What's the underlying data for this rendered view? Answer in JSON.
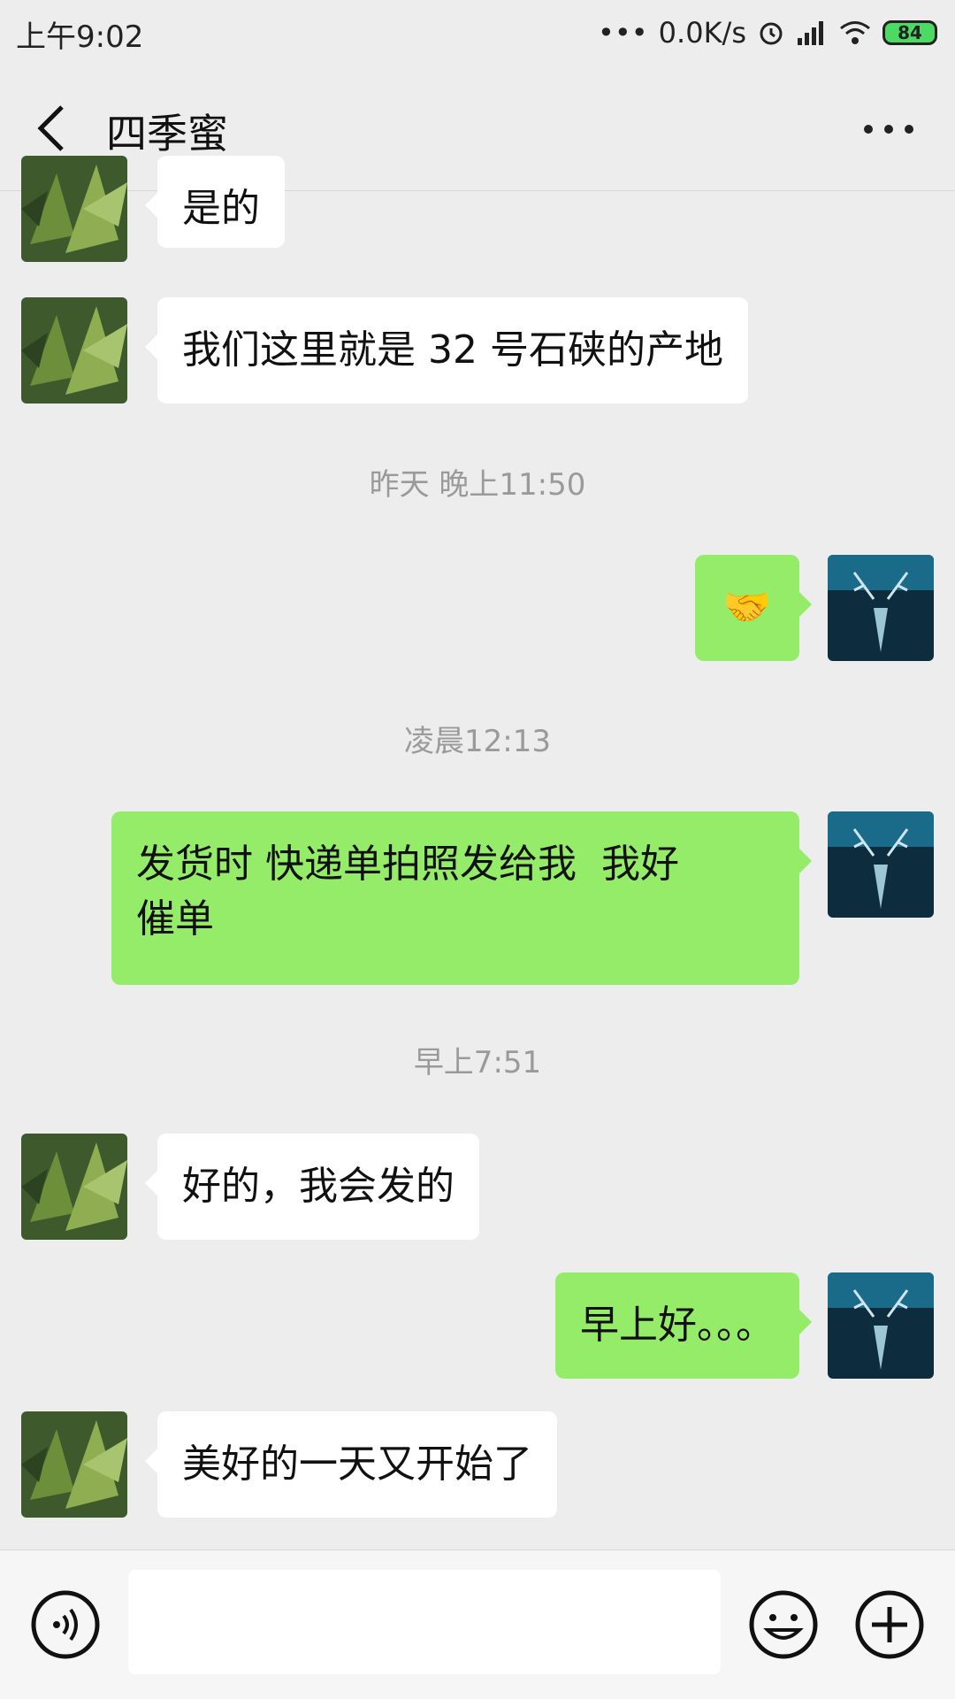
{
  "status_bar": {
    "time": "上午9:02",
    "net_speed": "0.0K/s",
    "battery": "84"
  },
  "header": {
    "title": "四季蜜"
  },
  "messages": [
    {
      "text": "是的"
    },
    {
      "text": "我们这里就是 32 号石硖的产地"
    },
    {
      "text": "🤝"
    },
    {
      "text": "发货时 快递单拍照发给我  我好\n催单"
    },
    {
      "text": "好的，我会发的"
    },
    {
      "text": "早上好。。。"
    },
    {
      "text": "美好的一天又开始了"
    }
  ],
  "timestamps": [
    "昨天 晚上11:50",
    "凌晨12:13",
    "早上7:51"
  ],
  "input": {
    "value": ""
  },
  "colors": {
    "background": "#ededed",
    "bubble_incoming": "#ffffff",
    "bubble_outgoing": "#95ec69"
  }
}
